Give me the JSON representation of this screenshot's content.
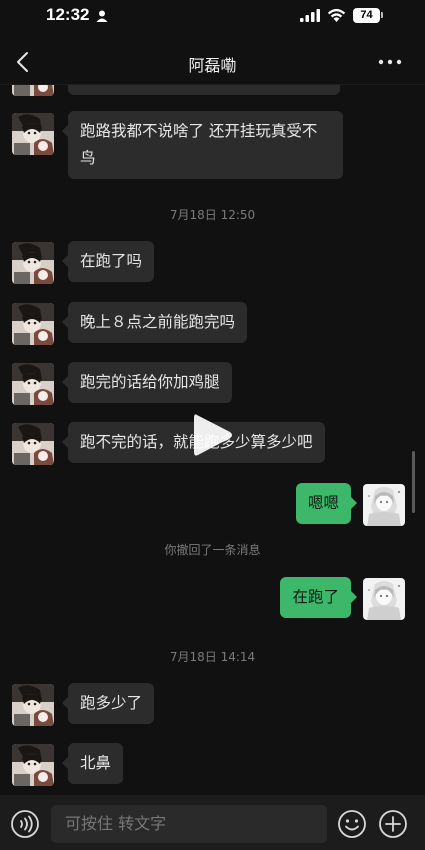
{
  "status_bar": {
    "time": "12:32",
    "battery": "74",
    "icons": [
      "person-icon",
      "signal-icon",
      "wifi-icon",
      "battery-icon"
    ]
  },
  "nav": {
    "title": "阿磊嘞",
    "back_icon": "chevron-left-icon",
    "more_icon": "more-dots-icon"
  },
  "messages": [
    {
      "type": "incoming",
      "text": ""
    },
    {
      "type": "incoming",
      "text": "跑路我都不说啥了 还开挂玩真受不鸟"
    },
    {
      "type": "time",
      "text": "7月18日 12:50"
    },
    {
      "type": "incoming",
      "text": "在跑了吗"
    },
    {
      "type": "incoming",
      "text": "晚上８点之前能跑完吗"
    },
    {
      "type": "incoming",
      "text": "跑完的话给你加鸡腿"
    },
    {
      "type": "incoming",
      "text": "跑不完的话，就能跑多少算多少吧"
    },
    {
      "type": "outgoing",
      "text": "嗯嗯"
    },
    {
      "type": "system",
      "text": "你撤回了一条消息"
    },
    {
      "type": "outgoing",
      "text": "在跑了"
    },
    {
      "type": "time",
      "text": "7月18日 14:14"
    },
    {
      "type": "incoming",
      "text": "跑多少了"
    },
    {
      "type": "incoming",
      "text": "北鼻"
    }
  ],
  "input_bar": {
    "placeholder": "可按住 转文字",
    "voice_icon": "voice-icon",
    "emoji_icon": "emoji-icon",
    "plus_icon": "plus-icon"
  },
  "colors": {
    "background": "#111111",
    "incoming_bubble": "#2c2c2c",
    "outgoing_bubble": "#3db86a",
    "muted_text": "#7a7a7a"
  },
  "overlay": {
    "play_icon": "play-icon"
  }
}
